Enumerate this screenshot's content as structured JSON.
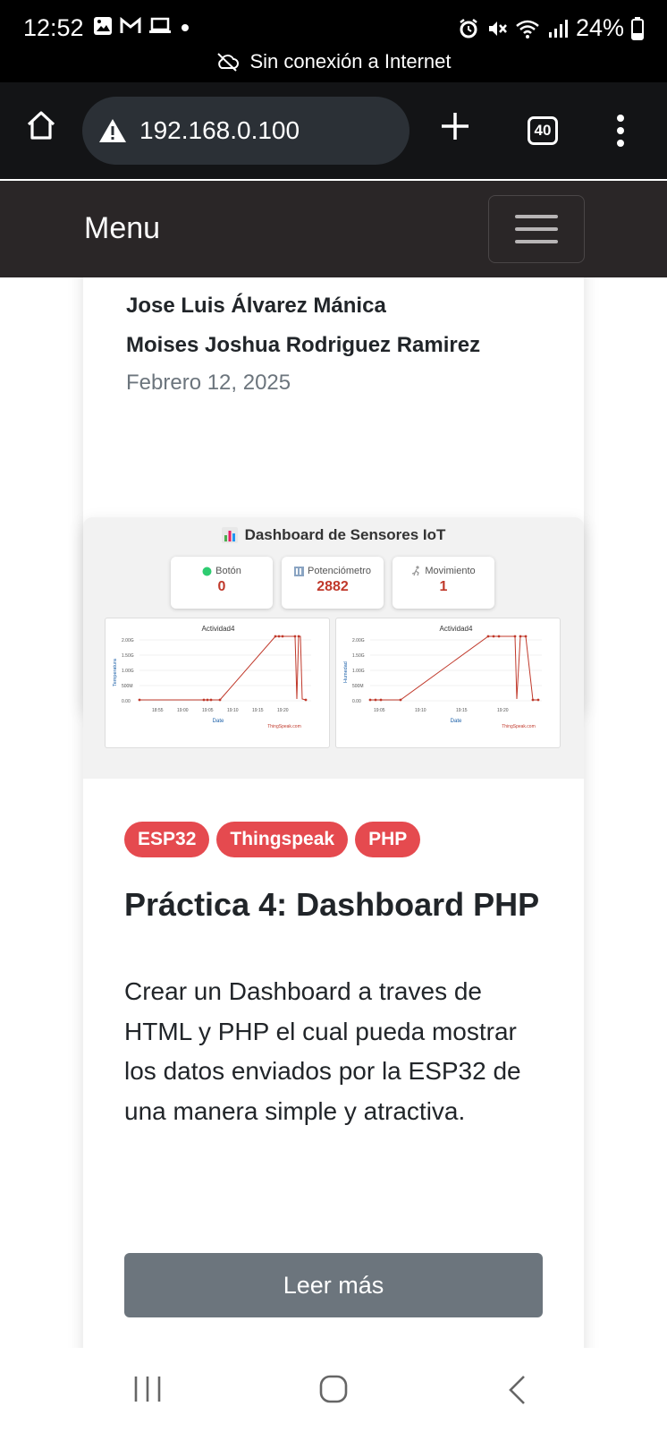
{
  "status_bar": {
    "time": "12:52",
    "battery": "24%",
    "offline_text": "Sin conexión a Internet"
  },
  "browser": {
    "url": "192.168.0.100",
    "tab_count": "40"
  },
  "navbar": {
    "brand": "Menu"
  },
  "prev_card": {
    "author1": "Jose Luis Álvarez Mánica",
    "author2": "Moises Joshua Rodriguez Ramirez",
    "date": "Febrero 12, 2025"
  },
  "card": {
    "image": {
      "title": "Dashboard de Sensores IoT",
      "stats": [
        {
          "label": "Botón",
          "value": "0",
          "icon": "green-dot-icon"
        },
        {
          "label": "Potenciómetro",
          "value": "2882",
          "icon": "abacus-icon"
        },
        {
          "label": "Movimiento",
          "value": "1",
          "icon": "runner-icon"
        }
      ],
      "charts": [
        {
          "title": "Actividad4",
          "ylabel": "Temperatura",
          "xlabel": "Date",
          "credit": "ThingSpeak.com",
          "yticks": [
            "2.00G",
            "1.50G",
            "1.00G",
            "500M",
            "0.00"
          ],
          "xticks": [
            "18:55",
            "19:00",
            "19:05",
            "19:10",
            "19:15",
            "19:20"
          ]
        },
        {
          "title": "Actividad4",
          "ylabel": "Humedad",
          "xlabel": "Date",
          "credit": "ThingSpeak.com",
          "yticks": [
            "2.00G",
            "1.50G",
            "1.00G",
            "500M",
            "0.00"
          ],
          "xticks": [
            "19:05",
            "19:10",
            "19:15",
            "19:20"
          ]
        }
      ]
    },
    "badges": [
      "ESP32",
      "Thingspeak",
      "PHP"
    ],
    "title": "Práctica 4: Dashboard PHP",
    "text": "Crear un Dashboard a traves de HTML y PHP el cual pueda mostrar los datos enviados por la ESP32 de una manera simple y atractiva.",
    "button": "Leer más"
  },
  "colors": {
    "badge": "#e54a4f",
    "button": "#6c757d",
    "navbar": "#2a2627",
    "browser_bar": "#131416",
    "chart_line": "#c0392b"
  }
}
